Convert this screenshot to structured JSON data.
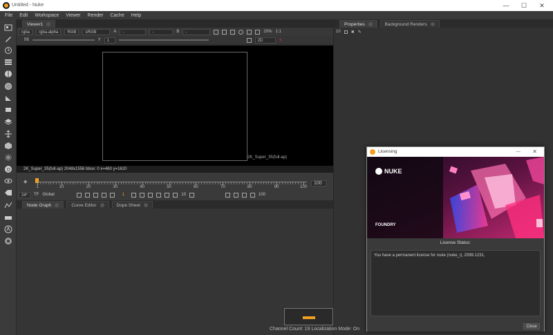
{
  "window": {
    "title": "Untitled - Nuke",
    "controls": [
      "—",
      "☐",
      "✕"
    ]
  },
  "menu": [
    "File",
    "Edit",
    "Workspace",
    "Viewer",
    "Render",
    "Cache",
    "Help"
  ],
  "viewer": {
    "tab": "Viewer1",
    "channels": "rgba",
    "layer": "rgba.alpha",
    "colorspace_mode": "RGB",
    "display": "sRGB",
    "input_a": "A",
    "input_a_value": "-",
    "input_a2": "-",
    "input_b": "B",
    "input_b_value": "-",
    "zoom": "20%",
    "ratio": "1:1",
    "fstop": "f/8",
    "gain_value": "1",
    "y_label": "Y",
    "y_value": "1",
    "view_mode": "2D",
    "format_label": "2K_Super_35(full-ap)",
    "info": "2K_Super_35(full-ap) 2048x1556  bbox: 0   x=460 y=1620",
    "timeline": {
      "start": "1",
      "end": "100",
      "ticks": [
        "1",
        "10",
        "20",
        "30",
        "40",
        "50",
        "60",
        "70",
        "80",
        "90",
        "100"
      ],
      "fps": "24*",
      "tf": "TF",
      "scope": "Global",
      "current_frame": "1",
      "step": "10",
      "end_field": "100"
    }
  },
  "bottom_tabs": [
    {
      "label": "Node Graph",
      "active": true
    },
    {
      "label": "Curve Editor",
      "active": false
    },
    {
      "label": "Dope Sheet",
      "active": false
    }
  ],
  "properties": {
    "tabs": [
      {
        "label": "Properties",
        "active": true
      },
      {
        "label": "Background Renders",
        "active": false
      }
    ],
    "max_panels": "10"
  },
  "license_dialog": {
    "title": "Licensing",
    "brand": "NUKE",
    "foundry": "FOUNDRY",
    "status_label": "License Status:",
    "message": "You have a permanent license for nuke (nuke_i), 2099.1231,",
    "close": "Close"
  },
  "statusbar": "Channel Count: 19  Localization Mode: On",
  "colors": {
    "accent_orange": "#f0a020",
    "viewer_bg": "#000000",
    "panel_bg": "#323232"
  }
}
